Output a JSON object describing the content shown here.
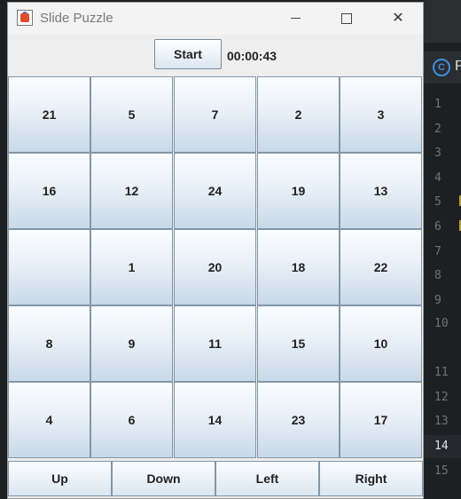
{
  "window": {
    "title": "Slide Puzzle",
    "icon": "java-cup-icon",
    "controls": [
      "minimize-icon",
      "maximize-icon",
      "close-icon"
    ]
  },
  "toolbar": {
    "start_label": "Start",
    "timer": "00:00:43"
  },
  "board": {
    "rows": [
      [
        "21",
        "5",
        "7",
        "2",
        "3"
      ],
      [
        "16",
        "12",
        "24",
        "19",
        "13"
      ],
      [
        "",
        "1",
        "20",
        "18",
        "22"
      ],
      [
        "8",
        "9",
        "11",
        "15",
        "10"
      ],
      [
        "4",
        "6",
        "14",
        "23",
        "17"
      ]
    ]
  },
  "controls": {
    "up": "Up",
    "down": "Down",
    "left": "Left",
    "right": "Right"
  },
  "ide": {
    "tab_text": "P",
    "tab_icon": "C",
    "line_numbers": [
      "1",
      "2",
      "3",
      "4",
      "5",
      "6",
      "7",
      "8",
      "9",
      "10",
      "11",
      "12",
      "13",
      "14",
      "15"
    ],
    "active_line": "14",
    "colors": {
      "background": "#1e1f22",
      "line_number": "#6f737a",
      "accent": "#3d8fe0"
    }
  }
}
